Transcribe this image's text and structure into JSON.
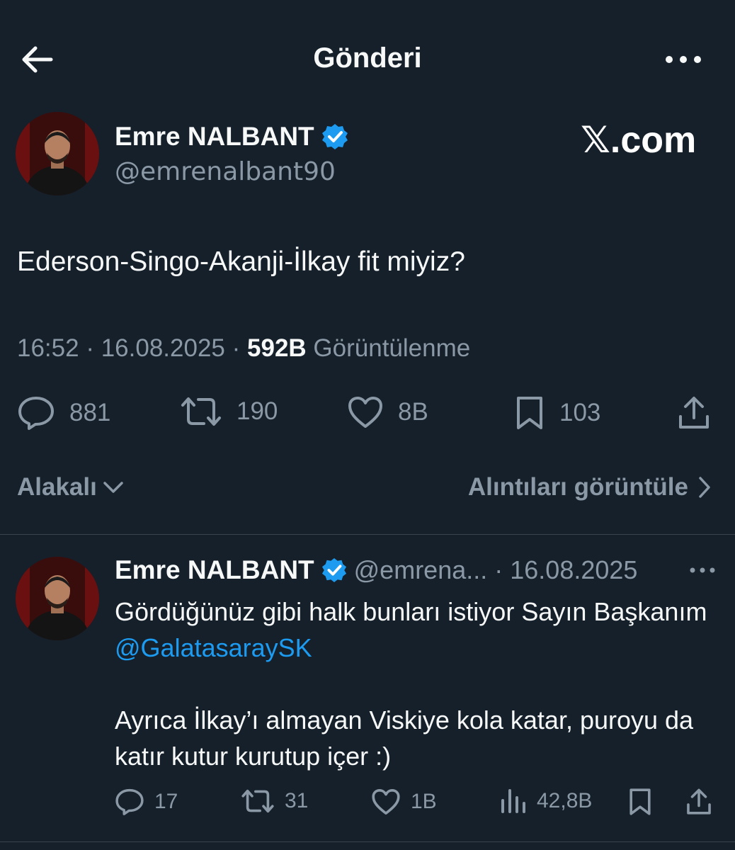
{
  "header": {
    "title": "Gönderi"
  },
  "tweet": {
    "author_name": "Emre NALBANT",
    "handle": "@emrenalbant90",
    "watermark": "𝕏.com",
    "text": "Ederson-Singo-Akanji-İlkay fit miyiz?",
    "time": "16:52",
    "sep1": "·",
    "date": "16.08.2025",
    "sep2": "·",
    "views_count": "592B",
    "views_label": "Görüntülenme",
    "replies": "881",
    "retweets": "190",
    "likes": "8B",
    "bookmarks": "103"
  },
  "sort": {
    "label": "Alakalı"
  },
  "quotes_link": {
    "label": "Alıntıları görüntüle"
  },
  "reply": {
    "author_name": "Emre NALBANT",
    "handle": "@emrena...",
    "separator": "·",
    "date": "16.08.2025",
    "text_line1": "Gördüğünüz gibi halk bunları istiyor Sayın Başkanım ",
    "mention": "@GalatasaraySK",
    "text_para2": "Ayrıca İlkay’ı almayan Viskiye kola katar, puroyu da katır kutur kurutup içer :)",
    "replies": "17",
    "retweets": "31",
    "likes": "1B",
    "views": "42,8B"
  },
  "colors": {
    "background": "#15202b",
    "text_primary": "#f7f9f9",
    "text_secondary": "#8b98a5",
    "accent": "#1d9bf0",
    "divider": "#38444d"
  },
  "icons": [
    "back-arrow-icon",
    "more-icon",
    "verified-badge-icon",
    "reply-icon",
    "retweet-icon",
    "like-icon",
    "bookmark-icon",
    "share-icon",
    "chevron-down-icon",
    "chevron-right-icon",
    "views-icon"
  ]
}
